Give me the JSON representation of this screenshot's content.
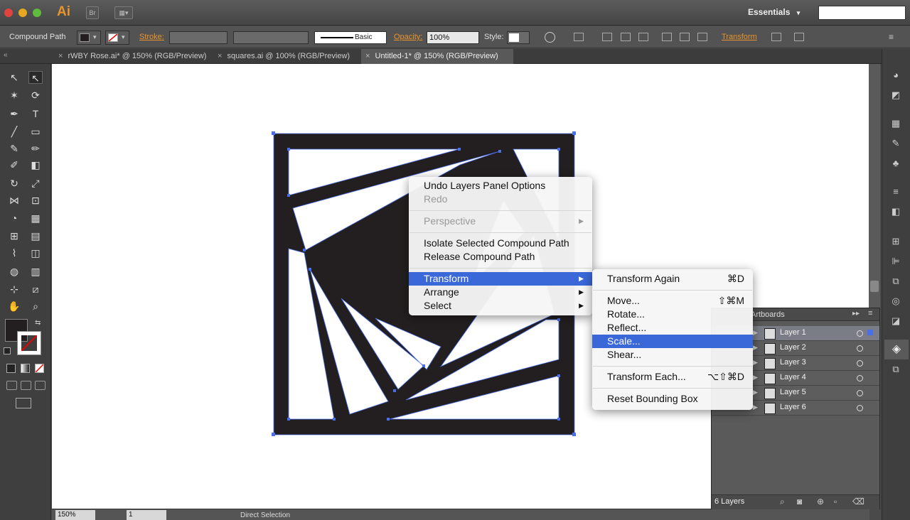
{
  "app": {
    "logo": "Ai",
    "bridge": "Br",
    "workspace": "Essentials",
    "workspace_arrow": "▾",
    "search_value": ""
  },
  "control_bar": {
    "selection_type": "Compound Path",
    "stroke_label": "Stroke:",
    "brush_label": "Basic",
    "opacity_label": "Opacity:",
    "opacity_value": "100%",
    "style_label": "Style:",
    "transform_label": "Transform"
  },
  "tabs": [
    {
      "label": "rWBY Rose.ai* @ 150% (RGB/Preview)"
    },
    {
      "label": "squares.ai @ 100% (RGB/Preview)"
    },
    {
      "label": "Untitled-1* @ 150% (RGB/Preview)"
    }
  ],
  "status": {
    "zoom": "150%",
    "artboard": "1",
    "tool": "Direct Selection"
  },
  "context_menu": {
    "undo": "Undo Layers Panel Options",
    "redo": "Redo",
    "perspective": "Perspective",
    "isolate": "Isolate Selected Compound Path",
    "release": "Release Compound Path",
    "transform": "Transform",
    "arrange": "Arrange",
    "select": "Select",
    "submenu_arrow": "▶"
  },
  "transform_menu": {
    "again": "Transform Again",
    "again_sc": "⌘D",
    "move": "Move...",
    "move_sc": "⇧⌘M",
    "rotate": "Rotate...",
    "reflect": "Reflect...",
    "scale": "Scale...",
    "shear": "Shear...",
    "each": "Transform Each...",
    "each_sc": "⌥⇧⌘D",
    "reset": "Reset Bounding Box"
  },
  "layers_panel": {
    "tab_label": "Artboards",
    "count": "6 Layers",
    "layers": [
      "Layer 1",
      "Layer 2",
      "Layer 3",
      "Layer 4",
      "Layer 5",
      "Layer 6"
    ],
    "selected_index": 0
  },
  "colors": {
    "accent": "#3a68d8",
    "orange": "#e8932b",
    "art": "#231f20",
    "selection": "#4a6fe8"
  }
}
